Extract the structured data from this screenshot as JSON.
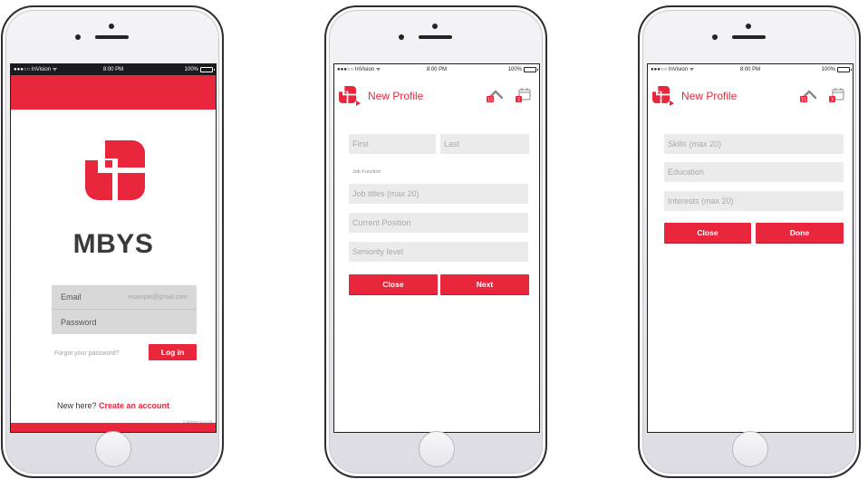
{
  "brand_color": "#e8273d",
  "status_bar": {
    "carrier": "●●●○○ InVision ᯤ",
    "time": "8:00 PM",
    "battery": "100%"
  },
  "login": {
    "brand_name": "MBYS",
    "email_label": "Email",
    "email_placeholder": "example@gmail.com",
    "password_label": "Password",
    "forgot_password": "Forgot your password?",
    "login_button": "Log in",
    "new_here": "New here?",
    "create_account": "Create an account",
    "version": "© Mobius v1.0.4.5"
  },
  "profile_step1": {
    "title": "New Profile",
    "first_placeholder": "First",
    "last_placeholder": "Last",
    "job_function_label": "Job Function",
    "job_titles_placeholder": "Job titles (max 20)",
    "current_position_placeholder": "Current Position",
    "seniority_placeholder": "Seniority level",
    "close_button": "Close",
    "next_button": "Next",
    "up_icon_badge": "15",
    "calendar_icon_badge": "3"
  },
  "profile_step2": {
    "title": "New Profile",
    "skills_placeholder": "Skills (max 20)",
    "education_placeholder": "Education",
    "interests_placeholder": "Interests (max 20)",
    "close_button": "Close",
    "done_button": "Done",
    "up_icon_badge": "15",
    "calendar_icon_badge": "3"
  }
}
